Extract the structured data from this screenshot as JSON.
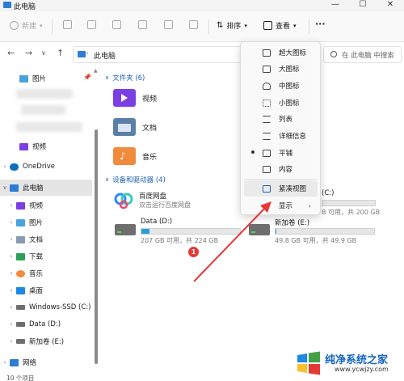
{
  "window": {
    "title": "此电脑",
    "min_glyph": "—",
    "max_glyph": "☐",
    "close_glyph": "✕"
  },
  "toolbar": {
    "new_label": "新建",
    "sort_label": "排序",
    "view_label": "查看",
    "more_label": "···"
  },
  "nav": {
    "address_path": "此电脑",
    "search_placeholder": "在 此电脑 中搜索"
  },
  "sidebar": {
    "quick_pictures": "图片",
    "onedrive": "OneDrive",
    "this_pc": "此电脑",
    "items": [
      {
        "label": "视频",
        "icon": "video-icon"
      },
      {
        "label": "图片",
        "icon": "picture-icon"
      },
      {
        "label": "文档",
        "icon": "document-icon"
      },
      {
        "label": "下载",
        "icon": "download-icon"
      },
      {
        "label": "音乐",
        "icon": "music-icon"
      },
      {
        "label": "桌面",
        "icon": "desktop-icon"
      },
      {
        "label": "Windows-SSD (C:)",
        "icon": "drive-icon"
      },
      {
        "label": "Data (D:)",
        "icon": "drive-icon"
      },
      {
        "label": "新加卷 (E:)",
        "icon": "drive-icon"
      }
    ],
    "network": "网络"
  },
  "folders": {
    "header": "文件夹 (6)",
    "items": [
      {
        "label": "视频",
        "color": "#7b3fe4"
      },
      {
        "label": "文档",
        "color": "#5b7fa6"
      },
      {
        "label": "音乐",
        "color": "#f08a3c"
      }
    ]
  },
  "devices": {
    "header": "设备和驱动器 (4)",
    "baidu_name": "百度网盘",
    "baidu_desc": "双击运行百度网盘",
    "c_partial_name": "(C:)",
    "c_partial_info": "B 可用，共 200 GB",
    "d_name": "Data (D:)",
    "d_info": "207 GB 可用，共 224 GB",
    "d_used_fraction": 0.08,
    "e_name": "新加卷 (E:)",
    "e_info": "49.8 GB 可用，共 49.9 GB",
    "e_used_fraction": 0.01
  },
  "view_menu": {
    "items": [
      {
        "label": "超大图标"
      },
      {
        "label": "大图标"
      },
      {
        "label": "中图标"
      },
      {
        "label": "小图标"
      },
      {
        "label": "列表"
      },
      {
        "label": "详细信息"
      },
      {
        "label": "平铺",
        "selected": true
      },
      {
        "label": "内容"
      },
      {
        "label": "紧凑视图"
      },
      {
        "label": "显示"
      }
    ],
    "submenu_arrow": "›"
  },
  "status": {
    "items_count": "10 个项目"
  },
  "annotation": {
    "badge": "1",
    "color": "#e53935"
  },
  "watermark": {
    "title": "纯净系统之家",
    "url": "www.ycwjzy.com"
  }
}
